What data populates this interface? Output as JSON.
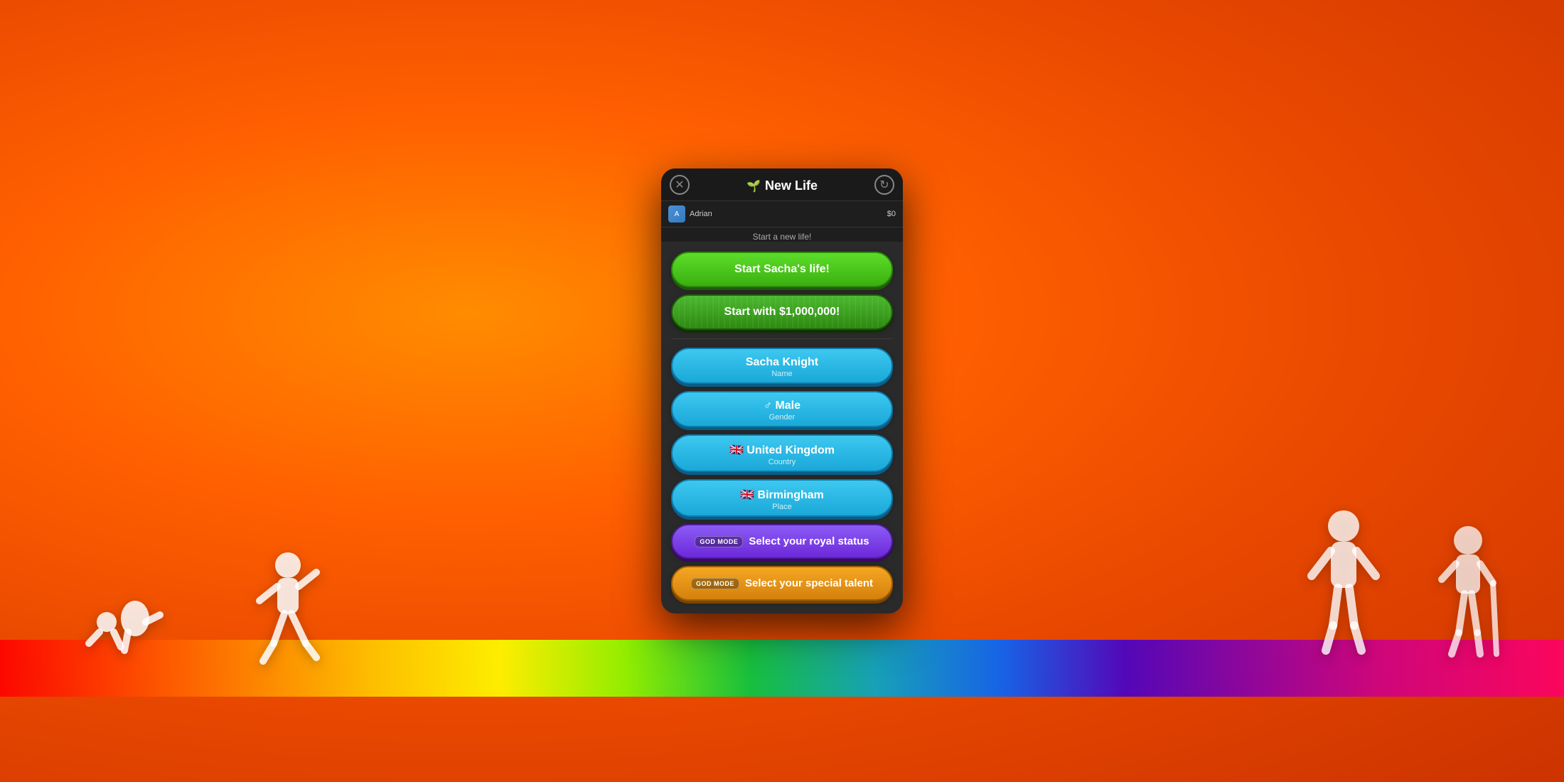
{
  "background": {
    "color_main": "#e84800"
  },
  "modal": {
    "title": "New Life",
    "title_icon": "🌱",
    "subtitle": "Start a new life!",
    "close_icon": "✕",
    "refresh_icon": "↻",
    "topbar": {
      "avatar_initial": "A",
      "name": "Adrian",
      "money": "$0"
    },
    "buttons": {
      "start_life": "Start Sacha's life!",
      "start_million": "Start with $1,000,000!",
      "name_label": "Sacha Knight",
      "name_sublabel": "Name",
      "gender_icon": "♂",
      "gender_label": "Male",
      "gender_sublabel": "Gender",
      "country_icon": "🇬🇧",
      "country_label": "United Kingdom",
      "country_sublabel": "Country",
      "city_icon": "🇬🇧",
      "city_label": "Birmingham",
      "city_sublabel": "Place",
      "royal_badge": "GOD MODE",
      "royal_label": "Select your royal status",
      "talent_badge": "GOD MODE",
      "talent_label": "Select your special talent"
    }
  }
}
